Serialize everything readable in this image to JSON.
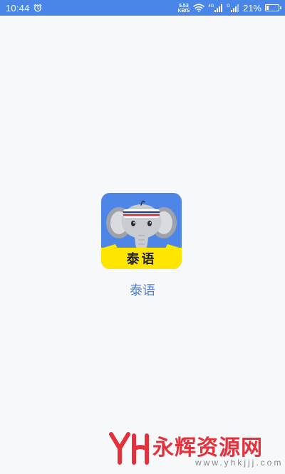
{
  "status_bar": {
    "time": "10:44",
    "net_speed_value": "5.53",
    "net_speed_unit": "KB/S",
    "signal_1_label": "4G",
    "signal_2_label": "G",
    "battery_percent": "21%",
    "battery_level": 0.21,
    "background_color": "#4a86e8"
  },
  "app": {
    "icon_label": "泰语",
    "name": "泰语",
    "icon_bg_color": "#4d86e6",
    "banner_color": "#ffe600",
    "name_color": "#4f7fd1"
  },
  "watermark": {
    "title": "永辉资源网",
    "url": "www.yhkjjj.com",
    "color": "#e3323b"
  },
  "icons": [
    "alarm-icon",
    "wifi-icon",
    "cell-signal-icon",
    "battery-icon",
    "elephant-icon"
  ]
}
